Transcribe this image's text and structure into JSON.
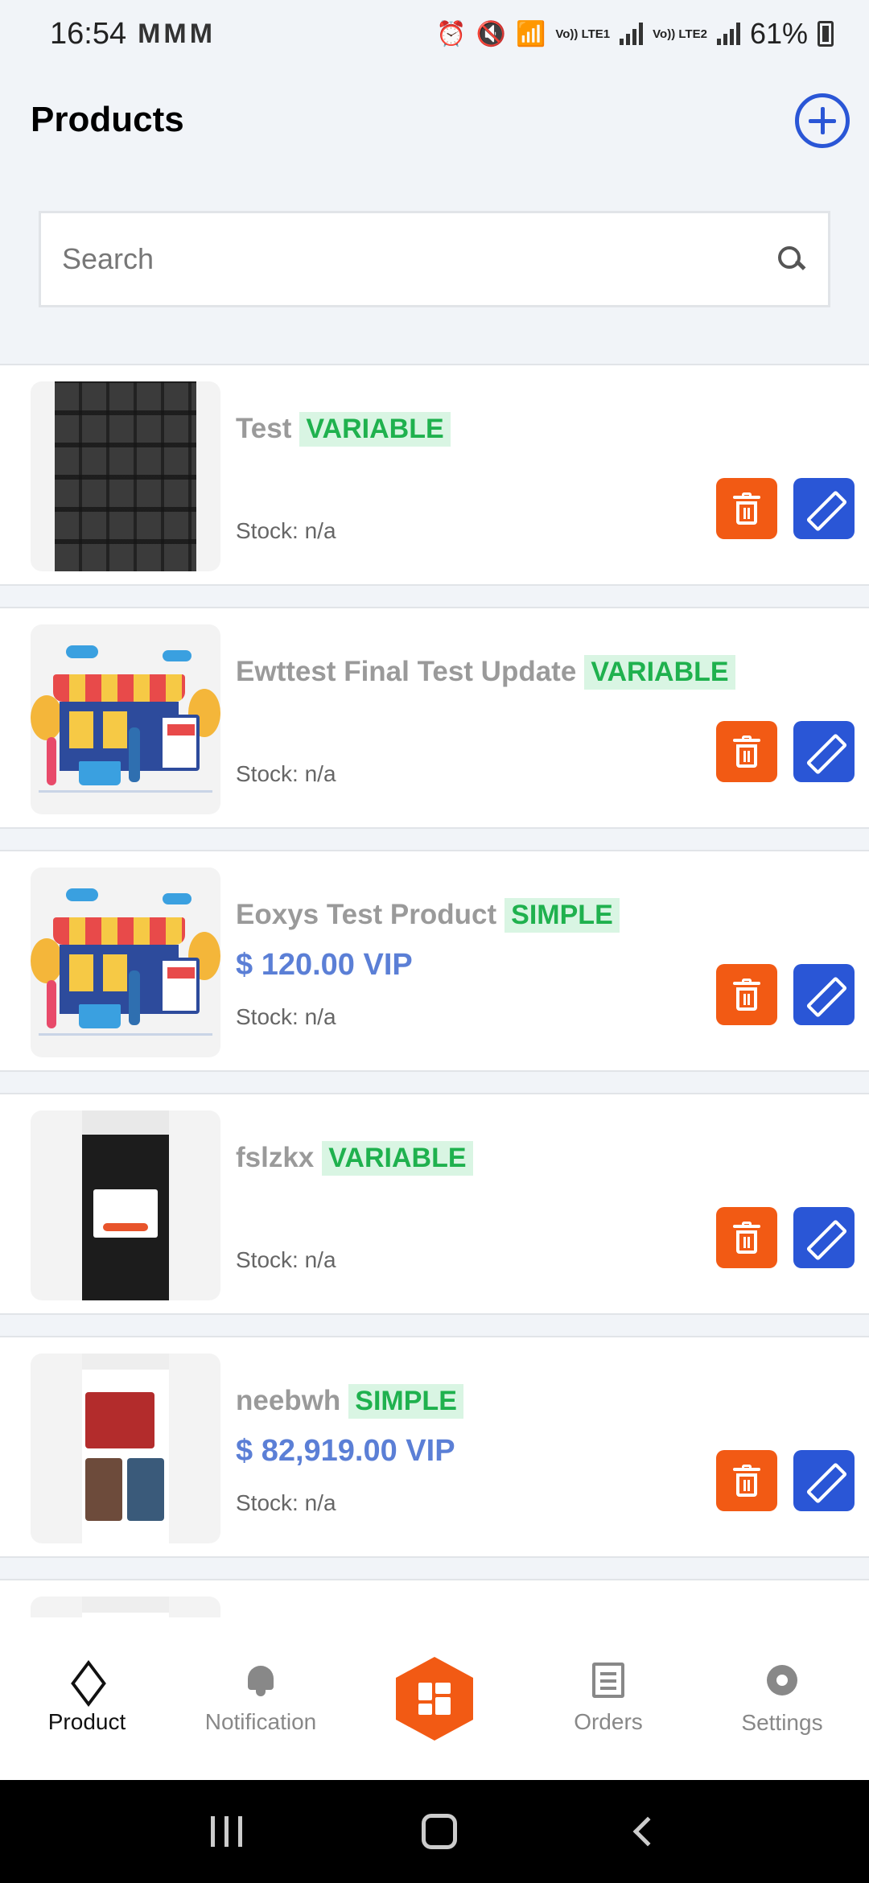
{
  "status_bar": {
    "time": "16:54",
    "mail_icons": "MMM",
    "lte1": "Vo)) LTE1",
    "lte2": "Vo)) LTE2",
    "battery": "61%"
  },
  "header": {
    "title": "Products"
  },
  "search": {
    "placeholder": "Search"
  },
  "products": [
    {
      "name": "Test",
      "type": "VARIABLE",
      "price": "",
      "stock": "Stock: n/a",
      "image": "keyboard-photo"
    },
    {
      "name": "Ewttest Final Test Update",
      "type": "VARIABLE",
      "price": "",
      "stock": "Stock: n/a",
      "image": "shop-illustration"
    },
    {
      "name": "Eoxys Test Product",
      "type": "SIMPLE",
      "price": "$ 120.00 VIP",
      "stock": "Stock: n/a",
      "image": "shop-illustration"
    },
    {
      "name": "fslzkx",
      "type": "VARIABLE",
      "price": "",
      "stock": "Stock: n/a",
      "image": "phone-screenshot"
    },
    {
      "name": "neebwh",
      "type": "SIMPLE",
      "price": "$ 82,919.00 VIP",
      "stock": "Stock: n/a",
      "image": "phone-screenshot-grid"
    }
  ],
  "bottom_nav": {
    "items": [
      {
        "label": "Product",
        "icon": "box-icon",
        "active": true
      },
      {
        "label": "Notification",
        "icon": "bell-icon",
        "active": false
      },
      {
        "label": "",
        "icon": "dashboard-icon",
        "active": false
      },
      {
        "label": "Orders",
        "icon": "orders-icon",
        "active": false
      },
      {
        "label": "Settings",
        "icon": "gear-icon",
        "active": false
      }
    ]
  },
  "colors": {
    "accent_blue": "#2a56d6",
    "delete_orange": "#f25a14",
    "type_green": "#1fb14e",
    "price_blue": "#5b7fd6"
  }
}
